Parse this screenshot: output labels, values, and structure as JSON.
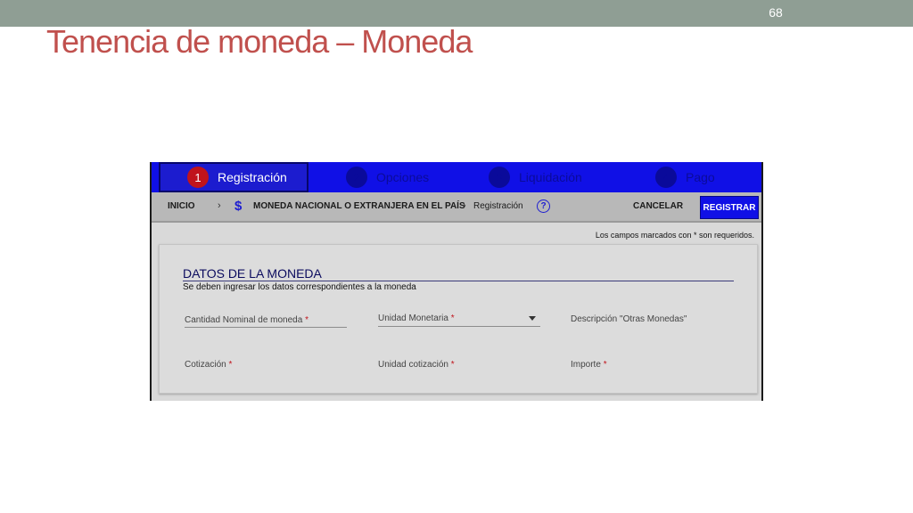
{
  "slide": {
    "number": "68",
    "title": "Tenencia de moneda – Moneda"
  },
  "stepper": {
    "steps": [
      {
        "num": "1",
        "label": "Registración",
        "active": true
      },
      {
        "num": "2",
        "label": "Opciones",
        "active": false
      },
      {
        "num": "3",
        "label": "Liquidación",
        "active": false
      },
      {
        "num": "4",
        "label": "Pago",
        "active": false
      }
    ]
  },
  "breadcrumb": {
    "home": "INICIO",
    "section": "MONEDA NACIONAL O EXTRANJERA EN EL PAÍS",
    "current": "Registración",
    "separator": "›"
  },
  "actions": {
    "cancel_label": "CANCELAR",
    "register_label": "REGISTRAR"
  },
  "required_note": "Los campos marcados con * son requeridos.",
  "form": {
    "title": "DATOS DE LA MONEDA",
    "subtitle": "Se deben ingresar los datos correspondientes a la moneda",
    "required_marker": "*",
    "fields": {
      "cantidad": "Cantidad Nominal de moneda",
      "unidad_monetaria": "Unidad Monetaria",
      "descripcion": "Descripción \"Otras Monedas\"",
      "cotizacion": "Cotización",
      "unidad_cotizacion": "Unidad cotización",
      "importe": "Importe"
    }
  },
  "colors": {
    "accent_red": "#c0504d",
    "primary_blue": "#1010e6",
    "step_active_badge": "#c0141c"
  }
}
